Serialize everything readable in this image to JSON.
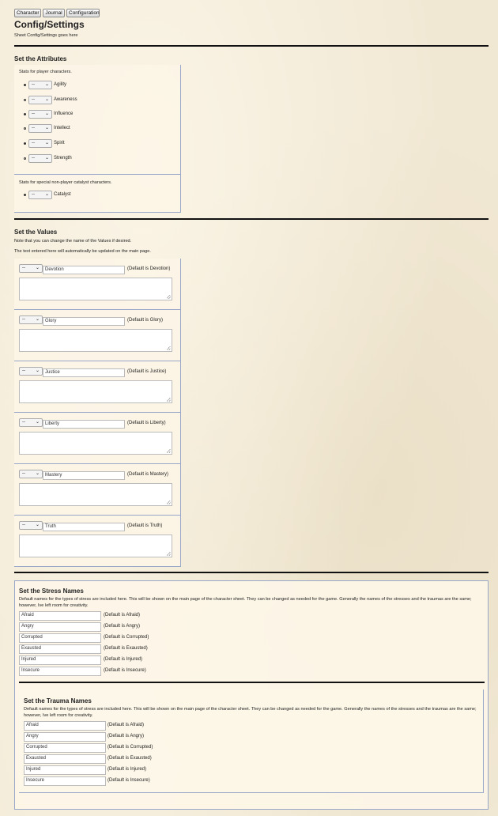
{
  "tabs": [
    "Character",
    "Journal",
    "Configuration"
  ],
  "page": {
    "title": "Config/Settings",
    "subtitle": "Sheet Config/Settings goes here"
  },
  "attributes": {
    "heading": "Set the Attributes",
    "intro": "Stats for player characters.",
    "select_value": "--",
    "items": [
      "Agility",
      "Awareness",
      "Influence",
      "Intellect",
      "Spirit",
      "Strength"
    ],
    "npc_intro": "Stats for special non-player catalyst characters.",
    "npc_items": [
      "Catalyst"
    ]
  },
  "values": {
    "heading": "Set the Values",
    "note1": "Note that you can change the name of the Values if desired.",
    "note2": "The text entered here will automatically be updated on the main page.",
    "select_value": "--",
    "items": [
      {
        "name": "Devotion",
        "default": "(Default is Devotion)"
      },
      {
        "name": "Glory",
        "default": "(Default is Glory)"
      },
      {
        "name": "Justice",
        "default": "(Default is Justice)"
      },
      {
        "name": "Liberty",
        "default": "(Default is Liberty)"
      },
      {
        "name": "Mastery",
        "default": "(Default is Mastery)"
      },
      {
        "name": "Truth",
        "default": "(Default is Truth)"
      }
    ]
  },
  "stress": {
    "heading": "Set the Stress Names",
    "desc": "Default names for the types of stress are included here.  This will be shown on the main page of the character sheet.  They can be changed as needed for the game. Generally the names of the stresses and the traumas are the same; however, Ive left room for creativity.",
    "items": [
      {
        "name": "Afraid",
        "default": "(Default is Afraid)"
      },
      {
        "name": "Angry",
        "default": "(Default is Angry)"
      },
      {
        "name": "Corrupted",
        "default": "(Default is Corrupted)"
      },
      {
        "name": "Exausted",
        "default": "(Default is Exausted)"
      },
      {
        "name": "Injured",
        "default": "(Default is Injured)"
      },
      {
        "name": "Insecure",
        "default": "(Default is Insecure)"
      }
    ]
  },
  "trauma": {
    "heading": "Set the Trauma Names",
    "desc": "Default names for the types of stress are included here. This will be shown on the main page of the character sheet.  They can be changed as needed for the game. Generally the names of the stresses and the traumas are the same; however, Ive left room for creativity.",
    "items": [
      {
        "name": "Afraid",
        "default": "(Default is Afraid)"
      },
      {
        "name": "Angry",
        "default": "(Default is Angry)"
      },
      {
        "name": "Corrupted",
        "default": "(Default is Corrupted)"
      },
      {
        "name": "Exausted",
        "default": "(Default is Exausted)"
      },
      {
        "name": "Injured",
        "default": "(Default is Injured)"
      },
      {
        "name": "Insecure",
        "default": "(Default is Insecure)"
      }
    ]
  }
}
